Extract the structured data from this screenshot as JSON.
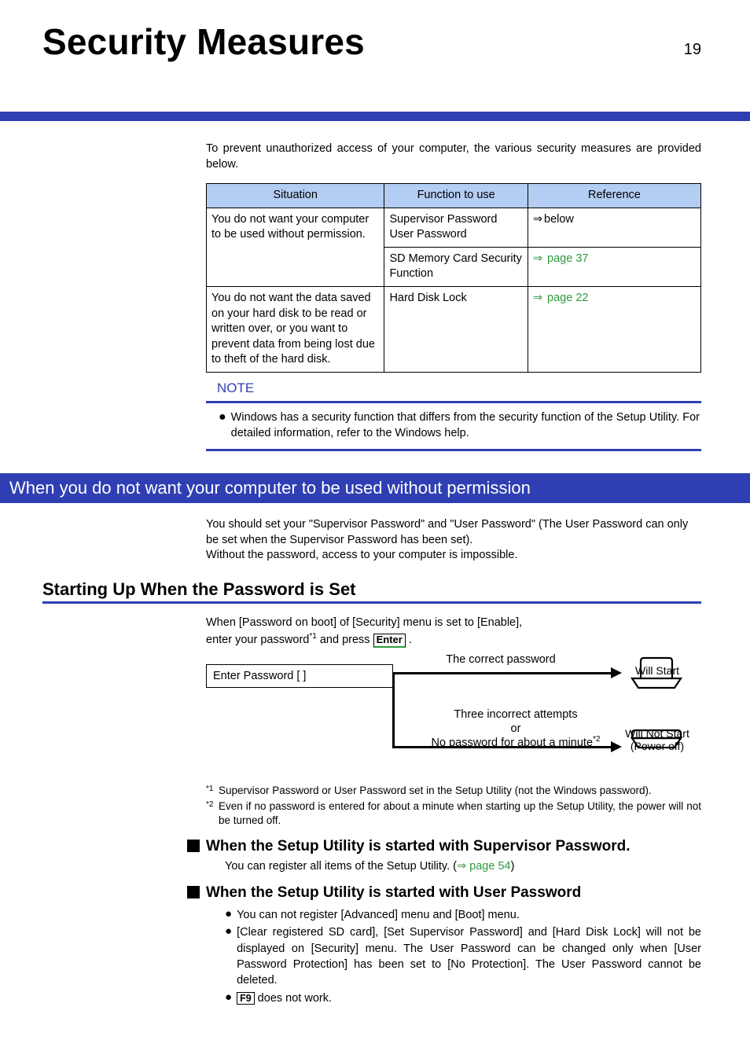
{
  "page": {
    "title": "Security Measures",
    "number": "19"
  },
  "intro": "To prevent unauthorized access of your computer, the various security measures are provided below.",
  "table": {
    "headers": {
      "situation": "Situation",
      "function": "Function to use",
      "reference": "Reference"
    },
    "row1_sit": "You do not want your computer to be used without permission.",
    "row1a_fun": "Supervisor Password\nUser Password",
    "row1a_ref_arrow": "⇒",
    "row1a_ref": "below",
    "row1b_fun": "SD Memory Card Security Function",
    "row1b_ref_arrow": "⇒",
    "row1b_ref": " page 37",
    "row2_sit": "You do not want the data saved on your hard disk to be read or written over, or you want to prevent data from being lost due to theft of the hard disk.",
    "row2_fun": "Hard Disk Lock",
    "row2_ref_arrow": "⇒",
    "row2_ref": " page 22"
  },
  "note": {
    "label": "NOTE",
    "text": "Windows has a security function that differs from the security function of the Setup Utility. For detailed information, refer to the Windows help."
  },
  "section_bar": "When you do not want your computer to be used without permission",
  "section_body_1": "You should set your \"Supervisor Password\" and \"User Password\" (The User Password can only be set when the Supervisor Password has been set).",
  "section_body_2": "Without the password, access to your computer is impossible.",
  "sub_h": "Starting Up When the Password is Set",
  "pwd_line_1": "When [Password on boot] of [Security] menu is set to [Enable],",
  "pwd_line_2_a": "enter your password",
  "pwd_line_2_sup": "*1",
  "pwd_line_2_b": " and press ",
  "enter_key": "Enter",
  "diagram": {
    "enter_box": "Enter  Password   [                  ]",
    "correct": "The correct password",
    "will_start": "Will Start",
    "three": "Three incorrect attempts",
    "or": "or",
    "nopwd_a": "No password for about a minute",
    "nopwd_sup": "*2",
    "will_not_start": "Will Not Start",
    "power_off": "(Power off)"
  },
  "footnotes": {
    "f1_mark": "*1",
    "f1": "Supervisor Password or User Password set in the Setup Utility (not the Windows password).",
    "f2_mark": "*2",
    "f2": "Even if no password is entered for about a minute when starting up the Setup Utility, the power will not be turned off."
  },
  "sup_head": "When the Setup Utility is started with Supervisor Password.",
  "sup_desc_a": "You can register all items of the Setup Utility. (",
  "sup_desc_link_arrow": "⇒",
  "sup_desc_link": " page 54",
  "sup_desc_b": ")",
  "user_head": "When the Setup Utility is started with User Password",
  "user_list": {
    "li1": "You can not register [Advanced] menu and [Boot] menu.",
    "li2": "[Clear registered SD card], [Set Supervisor Password] and [Hard Disk Lock] will not be displayed on [Security] menu. The User Password can be changed only when [User Password Protection] has been set to [No Protection]. The User Password cannot be deleted.",
    "li3_key": "F9",
    "li3_rest": " does not work."
  }
}
